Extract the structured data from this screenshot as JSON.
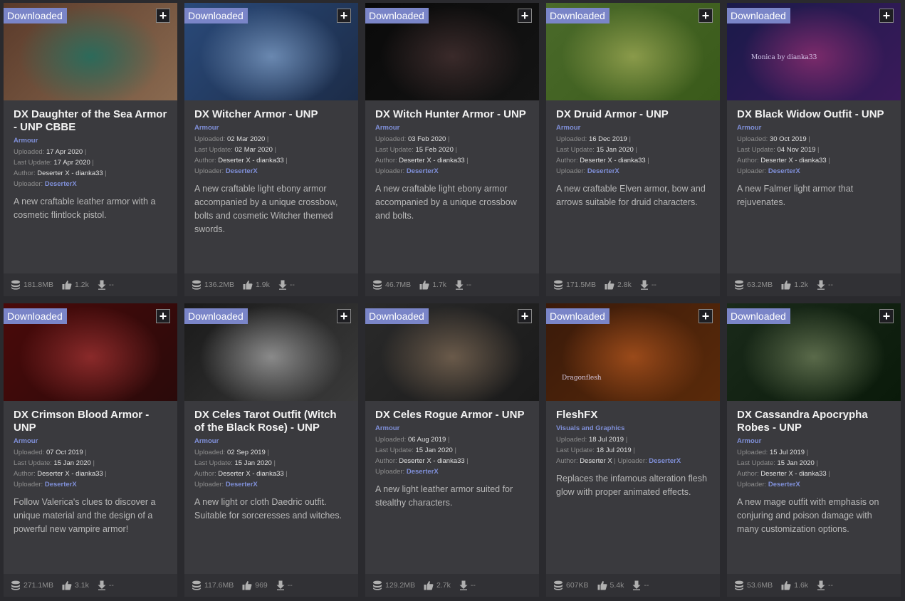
{
  "labels": {
    "downloaded": "Downloaded",
    "uploaded": "Uploaded:",
    "last_update": "Last Update:",
    "author": "Author:",
    "uploader": "Uploader:",
    "dash": "--"
  },
  "cards": [
    {
      "title": "DX Daughter of the Sea Armor - UNP CBBE",
      "category": "Armour",
      "uploaded": "17 Apr 2020",
      "last_update": "17 Apr 2020",
      "author": "Deserter X - dianka33",
      "uploader": "DeserterX",
      "description": "A new craftable leather armor with a cosmetic flintlock pistol.",
      "size": "181.8MB",
      "endorsements": "1.2k",
      "downloads": "--",
      "thumb_colors": [
        "#5a3a2a",
        "#2c6a5a",
        "#8a6a50"
      ]
    },
    {
      "title": "DX Witcher Armor - UNP",
      "category": "Armour",
      "uploaded": "02 Mar 2020",
      "last_update": "02 Mar 2020",
      "author": "Deserter X - dianka33",
      "uploader": "DeserterX",
      "description": "A new craftable light ebony armor accompanied by a unique crossbow, bolts and cosmetic Witcher themed swords.",
      "size": "136.2MB",
      "endorsements": "1.9k",
      "downloads": "--",
      "thumb_colors": [
        "#2a4a7a",
        "#6a88b0",
        "#1c2c48"
      ]
    },
    {
      "title": "DX Witch Hunter Armor - UNP",
      "category": "Armour",
      "uploaded": "03 Feb 2020",
      "last_update": "15 Feb 2020",
      "author": "Deserter X - dianka33",
      "uploader": "DeserterX",
      "description": "A new craftable light ebony armor accompanied by a unique crossbow and bolts.",
      "size": "46.7MB",
      "endorsements": "1.7k",
      "downloads": "--",
      "thumb_colors": [
        "#0a0a0a",
        "#3a2a2a",
        "#141414"
      ]
    },
    {
      "title": "DX Druid Armor - UNP",
      "category": "Armour",
      "uploaded": "16 Dec 2019",
      "last_update": "15 Jan 2020",
      "author": "Deserter X - dianka33",
      "uploader": "DeserterX",
      "description": "A new craftable Elven armor, bow and arrows suitable for druid characters.",
      "size": "171.5MB",
      "endorsements": "2.8k",
      "downloads": "--",
      "thumb_colors": [
        "#4a6a2a",
        "#8a9a4a",
        "#3a5a1a"
      ]
    },
    {
      "title": "DX Black Widow Outfit - UNP",
      "category": "Armour",
      "uploaded": "30 Oct 2019",
      "last_update": "04 Nov 2019",
      "author": "Deserter X - dianka33",
      "uploader": "DeserterX",
      "description": "A new Falmer light armor that rejuvenates.",
      "size": "63.2MB",
      "endorsements": "1.2k",
      "downloads": "--",
      "thumb_colors": [
        "#1a1a4a",
        "#7a2a6a",
        "#3a1a5a"
      ],
      "thumb_text": "Monica by dianka33"
    },
    {
      "title": "DX Crimson Blood Armor - UNP",
      "category": "Armour",
      "uploaded": "07 Oct 2019",
      "last_update": "15 Jan 2020",
      "author": "Deserter X - dianka33",
      "uploader": "DeserterX",
      "description": "Follow Valerica's clues to discover a unique material and the design of a powerful new vampire armor!",
      "size": "271.1MB",
      "endorsements": "3.1k",
      "downloads": "--",
      "thumb_colors": [
        "#4a0a0a",
        "#8a2a2a",
        "#2a0a0a"
      ]
    },
    {
      "title": "DX Celes Tarot Outfit (Witch of the Black Rose) - UNP",
      "category": "Armour",
      "uploaded": "02 Sep 2019",
      "last_update": "15 Jan 2020",
      "author": "Deserter X - dianka33",
      "uploader": "DeserterX",
      "description": "A new light or cloth Daedric outfit. Suitable for sorceresses and witches.",
      "size": "117.6MB",
      "endorsements": "969",
      "downloads": "--",
      "thumb_colors": [
        "#1a1a1a",
        "#8a8a8a",
        "#3a3a3a"
      ]
    },
    {
      "title": "DX Celes Rogue Armor - UNP",
      "category": "Armour",
      "uploaded": "06 Aug 2019",
      "last_update": "15 Jan 2020",
      "author": "Deserter X - dianka33",
      "uploader": "DeserterX",
      "description": "A new light leather armor suited for stealthy characters.",
      "size": "129.2MB",
      "endorsements": "2.7k",
      "downloads": "--",
      "thumb_colors": [
        "#2a2a2a",
        "#6a5a4a",
        "#1a1a1a"
      ]
    },
    {
      "title": "FleshFX",
      "category": "Visuals and Graphics",
      "uploaded": "18 Jul 2019",
      "last_update": "18 Jul 2019",
      "author": "Deserter X",
      "uploader": "DeserterX",
      "inline_uploader": true,
      "description": "Replaces the infamous alteration flesh glow with proper animated effects.",
      "size": "607KB",
      "endorsements": "5.4k",
      "downloads": "--",
      "thumb_colors": [
        "#3a1a0a",
        "#9a4a1a",
        "#5a2a0a"
      ],
      "thumb_text": "Dragonflesh"
    },
    {
      "title": "DX Cassandra Apocrypha Robes - UNP",
      "category": "Armour",
      "uploaded": "15 Jul 2019",
      "last_update": "15 Jan 2020",
      "author": "Deserter X - dianka33",
      "uploader": "DeserterX",
      "description": "A new mage outfit with emphasis on conjuring and poison damage with many customization options.",
      "size": "53.6MB",
      "endorsements": "1.6k",
      "downloads": "--",
      "thumb_colors": [
        "#1a2a1a",
        "#5a6a4a",
        "#0a1a0a"
      ]
    }
  ]
}
